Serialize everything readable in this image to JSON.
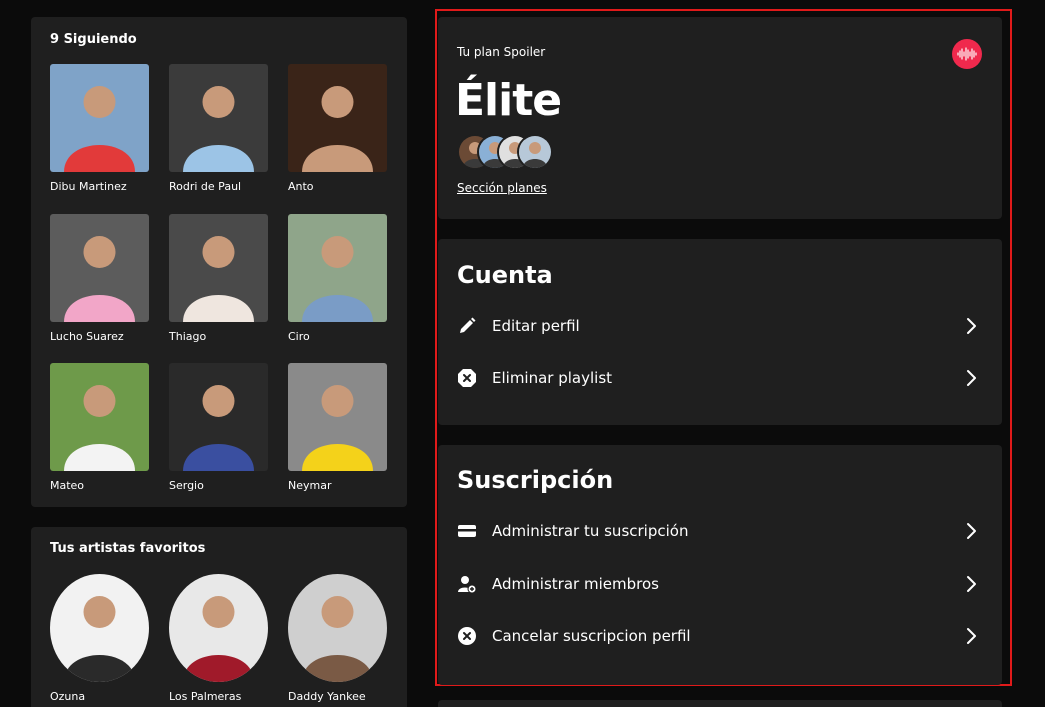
{
  "following": {
    "title": "9 Siguiendo",
    "people": [
      {
        "name": "Dibu Martinez",
        "bg": "#7fa3c8",
        "fg": "#e23a3a"
      },
      {
        "name": "Rodri de Paul",
        "bg": "#3b3b3b",
        "fg": "#9cc4e6"
      },
      {
        "name": "Anto",
        "bg": "#3a2418",
        "fg": "#c89a7a"
      },
      {
        "name": "Lucho Suarez",
        "bg": "#5c5c5c",
        "fg": "#f2a6c8"
      },
      {
        "name": "Thiago",
        "bg": "#4a4a4a",
        "fg": "#efe6df"
      },
      {
        "name": "Ciro",
        "bg": "#8fa58a",
        "fg": "#7a9cc6"
      },
      {
        "name": "Mateo",
        "bg": "#6e9a4a",
        "fg": "#f3f3f3"
      },
      {
        "name": "Sergio",
        "bg": "#2a2a2a",
        "fg": "#3a4fa0"
      },
      {
        "name": "Neymar",
        "bg": "#8a8a8a",
        "fg": "#f4d21a"
      }
    ]
  },
  "artists": {
    "title": "Tus artistas favoritos",
    "items": [
      {
        "name": "Ozuna",
        "bg": "#f2f2f2",
        "fg": "#2a2a2a"
      },
      {
        "name": "Los Palmeras",
        "bg": "#e8e8e8",
        "fg": "#a01a2a"
      },
      {
        "name": "Daddy Yankee",
        "bg": "#cfcfcf",
        "fg": "#7a5a45"
      }
    ]
  },
  "plan": {
    "label": "Tu plan Spoiler",
    "name": "Élite",
    "link": "Sección planes",
    "avatar_colors": [
      "#6b4a35",
      "#8ab0d6",
      "#e0e0e0",
      "#b7c8d8"
    ]
  },
  "cuenta": {
    "title": "Cuenta",
    "rows": [
      {
        "label": "Editar perfil",
        "icon": "pencil-icon"
      },
      {
        "label": "Eliminar playlist",
        "icon": "close-octagon-icon"
      }
    ]
  },
  "suscripcion": {
    "title": "Suscripción",
    "rows": [
      {
        "label": "Administrar tu suscripción",
        "icon": "card-icon"
      },
      {
        "label": "Administrar miembros",
        "icon": "add-user-icon"
      },
      {
        "label": "Cancelar suscripcion perfil",
        "icon": "close-circle-icon"
      }
    ]
  },
  "colors": {
    "accent": "#f0294d",
    "frame": "#e01a1a",
    "card": "#1f1f1f",
    "background": "#0b0b0b"
  }
}
